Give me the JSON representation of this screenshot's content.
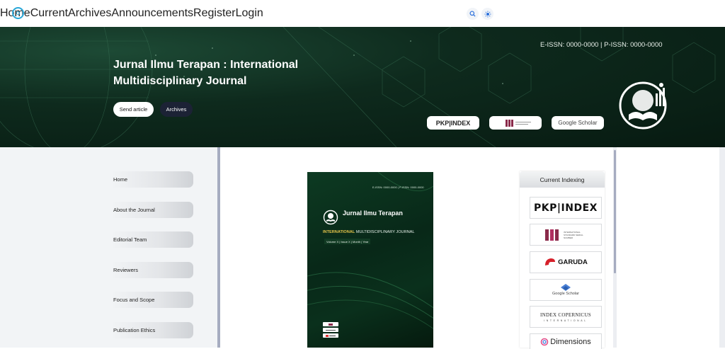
{
  "nav": {
    "items": [
      "Home",
      "Current",
      "Archives",
      "Announcements",
      "Register",
      "Login"
    ]
  },
  "icons": {
    "logo": "logo-icon",
    "search": "search-icon",
    "theme": "sun-icon"
  },
  "hero": {
    "title": "Jurnal Ilmu Terapan : International Multidisciplinary Journal",
    "issn": "E-ISSN: 0000-0000 | P-ISSN: 0000-0000",
    "send_button": "Send article",
    "archives_button": "Archives",
    "pkp_label": "PKP|INDEX",
    "google_scholar_label": "Google Scholar"
  },
  "sidebar": {
    "items": [
      "Home",
      "About the Journal",
      "Editorial Team",
      "Reviewers",
      "Focus and Scope",
      "Publication Ethics"
    ]
  },
  "cover": {
    "issn": "E-ISSN: 0000-0000 | P-ISSN: 0000-0000",
    "title": "Jurnal Ilmu Terapan",
    "subtitle_accent": "INTERNATIONAL",
    "subtitle_rest": " MULTIDISCIPLINARY JOURNAL",
    "volume": "Volume X | Issue X | Month | Year"
  },
  "indexing": {
    "heading": "Current Indexing",
    "pkp": "PKP|INDEX",
    "issn_text": "INTERNATIONAL STANDARD SERIAL NUMBER",
    "garuda": "GARUDA",
    "scholar": "Google Scholar",
    "copernicus": "INDEX COPERNICUS",
    "copernicus_sub": "INTERNATIONAL",
    "dimensions": "Dimensions"
  },
  "colors": {
    "accent": "#2aa7d8",
    "hero_dark": "#071a11",
    "archives_btn": "#1c2235",
    "cover_gold": "#e4c34a"
  }
}
